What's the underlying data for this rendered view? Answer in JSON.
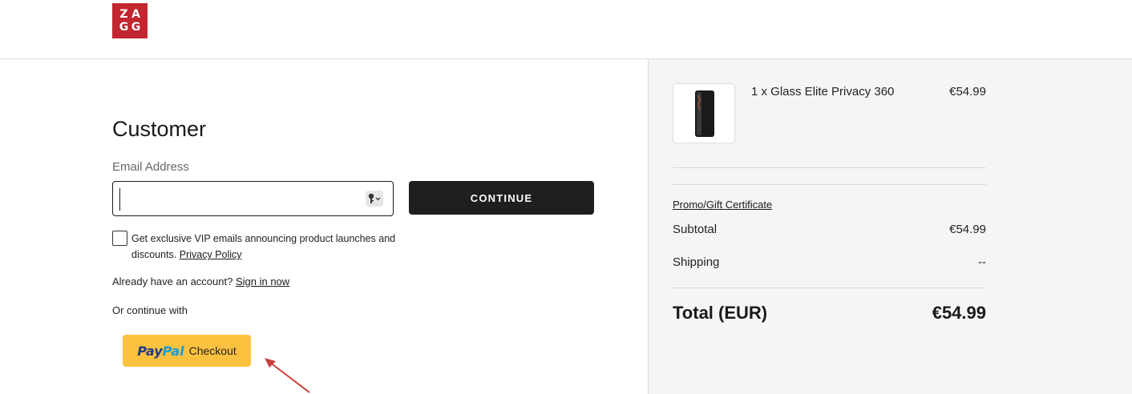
{
  "brand": {
    "logo_letters": [
      "Z",
      "A",
      "G",
      "G"
    ],
    "logo_color": "#c2262e"
  },
  "customer": {
    "title": "Customer",
    "email_label": "Email Address",
    "email_value": "",
    "continue_label": "CONTINUE",
    "vip_text": "Get exclusive VIP emails announcing product launches and discounts.",
    "privacy_link": "Privacy Policy",
    "account_prompt": "Already have an account?",
    "sign_in_link": "Sign in now",
    "or_continue": "Or continue with",
    "paypal": {
      "pay": "Pay",
      "pal": "Pal",
      "checkout": "Checkout",
      "button_color": "#fcc23f"
    }
  },
  "summary": {
    "item": {
      "quantity_name": "1 x Glass Elite Privacy 360",
      "price": "€54.99",
      "thumb_icon": "phone-case-icon"
    },
    "promo_link": "Promo/Gift Certificate",
    "subtotal_label": "Subtotal",
    "subtotal_value": "€54.99",
    "shipping_label": "Shipping",
    "shipping_value": "--",
    "total_label": "Total (EUR)",
    "total_value": "€54.99"
  },
  "annotation": {
    "arrow_color": "#c9403a"
  }
}
